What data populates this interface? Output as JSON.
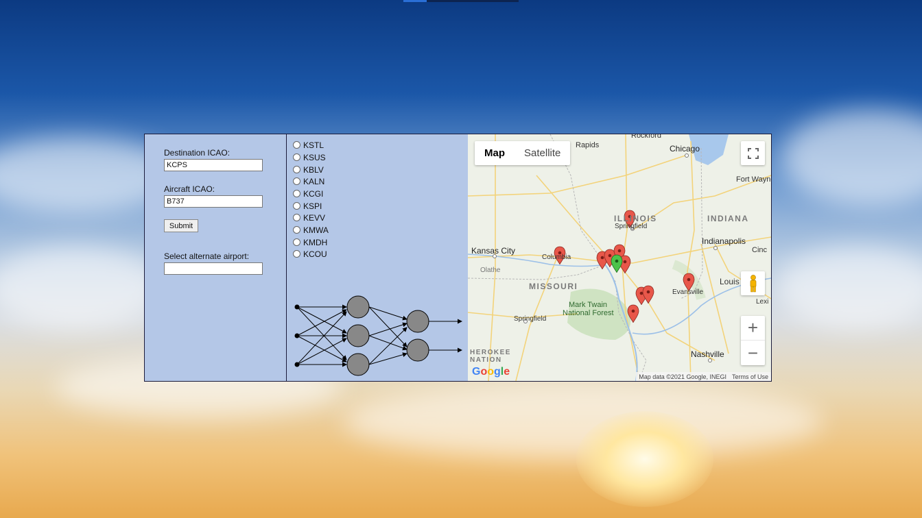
{
  "form": {
    "destination_label": "Destination ICAO:",
    "destination_value": "KCPS",
    "aircraft_label": "Aircraft ICAO:",
    "aircraft_value": "B737",
    "submit_label": "Submit",
    "alternate_label": "Select alternate airport:",
    "alternate_value": ""
  },
  "airports": [
    "KSTL",
    "KSUS",
    "KBLV",
    "KALN",
    "KCGI",
    "KSPI",
    "KEVV",
    "KMWA",
    "KMDH",
    "KCOU"
  ],
  "map": {
    "tab_map": "Map",
    "tab_satellite": "Satellite",
    "attribution": "Map data ©2021 Google, INEGI",
    "terms": "Terms of Use",
    "logo": "Google",
    "labels": {
      "rockford": "Rockford",
      "rapids": "Rapids",
      "chicago": "Chicago",
      "fort_wayne": "Fort Wayne",
      "illinois": "ILLINOIS",
      "springfield_il": "Springfield",
      "indiana": "INDIANA",
      "indianapolis": "Indianapolis",
      "kansas_city": "Kansas City",
      "columbia": "Columbia",
      "olathe": "Olathe",
      "cinc": "Cinc",
      "missouri": "MISSOURI",
      "louis": "Louis",
      "evansville": "Evansville",
      "lexi": "Lexi",
      "mark_twain": "Mark Twain",
      "national_forest": "National Forest",
      "springfield_mo": "Springfield",
      "herokee": "HEROKEE",
      "nation": "NATION",
      "nashville": "Nashville"
    },
    "icons": {
      "fullscreen": "fullscreen-icon",
      "pegman": "pegman-icon",
      "zoom_in": "+",
      "zoom_out": "−"
    },
    "colors": {
      "marker_red": "#e8574a",
      "marker_green": "#4cc34a"
    }
  },
  "colors": {
    "panel_bg": "#b4c7e7",
    "neuron_fill": "#888888"
  }
}
